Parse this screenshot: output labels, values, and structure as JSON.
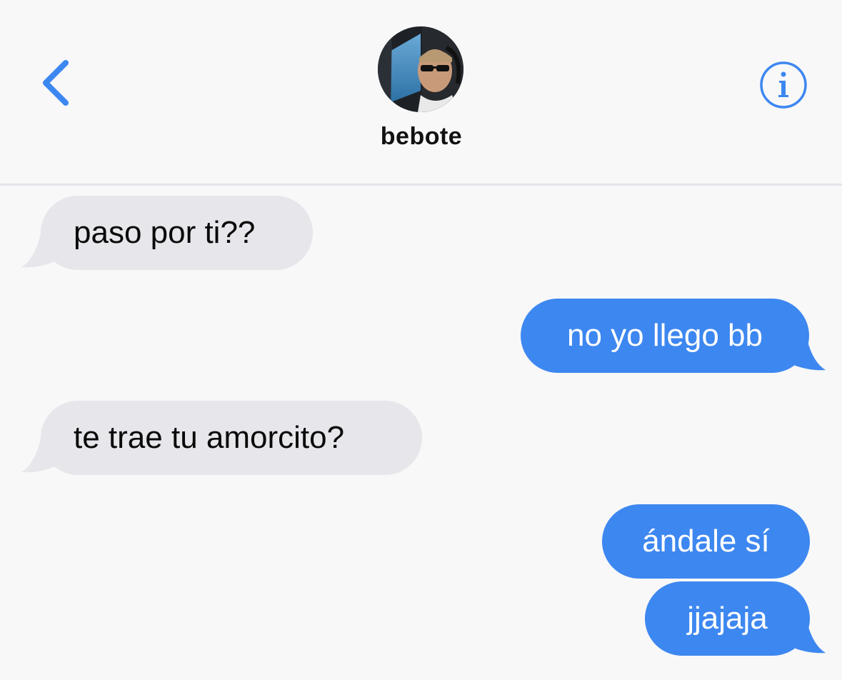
{
  "header": {
    "contact_name": "bebote",
    "back_icon": "chevron-left-icon",
    "info_icon": "info-circle-icon",
    "accent_color": "#3d87f0"
  },
  "messages": [
    {
      "direction": "incoming",
      "text": "paso por ti??"
    },
    {
      "direction": "outgoing",
      "text": "no yo llego bb"
    },
    {
      "direction": "incoming",
      "text": "te trae tu amorcito?"
    },
    {
      "direction": "outgoing",
      "text": "ándale sí"
    },
    {
      "direction": "outgoing",
      "text": "jjajaja"
    }
  ],
  "colors": {
    "incoming_bubble": "#e6e6eb",
    "outgoing_bubble": "#3d87f0",
    "background": "#f8f8f9"
  }
}
